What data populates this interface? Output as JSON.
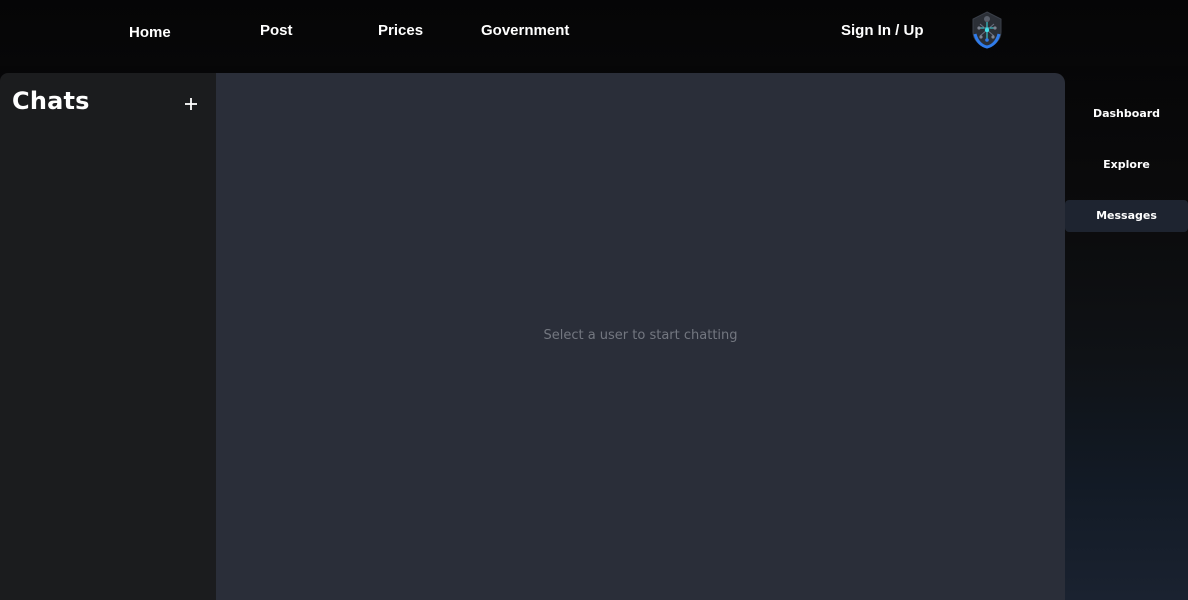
{
  "topnav": {
    "home": "Home",
    "post": "Post",
    "prices": "Prices",
    "government": "Government",
    "sign_in": "Sign In / Up",
    "logo_icon": "network-shield-logo-icon"
  },
  "chats": {
    "title": "Chats",
    "add_icon": "plus-icon"
  },
  "main": {
    "empty_message": "Select a user to start chatting"
  },
  "side_nav": {
    "items": [
      {
        "label": "Dashboard",
        "active": false
      },
      {
        "label": "Explore",
        "active": false
      },
      {
        "label": "Messages",
        "active": true
      }
    ]
  },
  "colors": {
    "chat_panel_bg": "#2a2e39",
    "sidebar_bg": "#1b1c1e",
    "active_nav_bg": "#1e2430",
    "accent_blue": "#2f7bea",
    "accent_cyan": "#3fe0e8"
  }
}
